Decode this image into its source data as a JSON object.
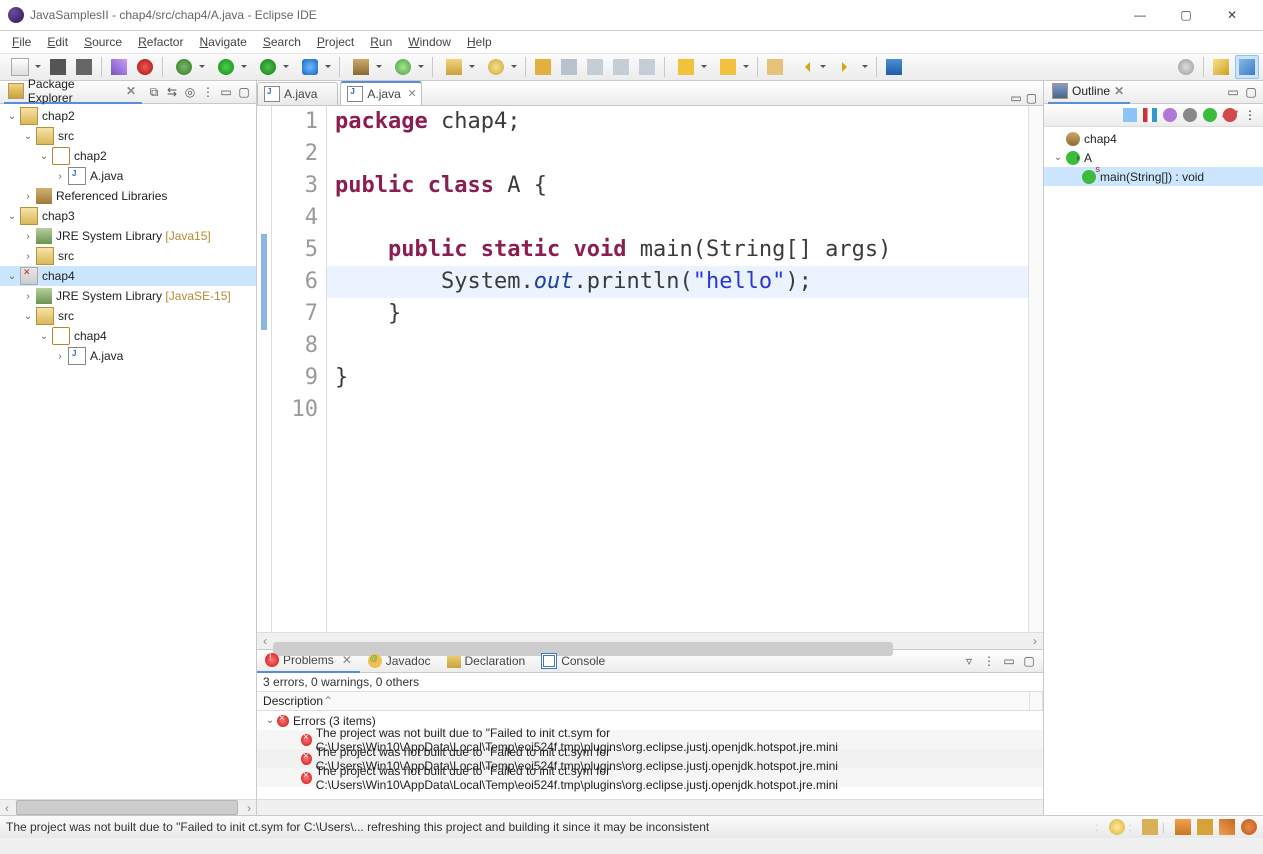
{
  "titlebar": {
    "title": "JavaSamplesII - chap4/src/chap4/A.java - Eclipse IDE"
  },
  "menu": [
    "File",
    "Edit",
    "Source",
    "Refactor",
    "Navigate",
    "Search",
    "Project",
    "Run",
    "Window",
    "Help"
  ],
  "package_explorer": {
    "title": "Package Explorer",
    "tree": {
      "chap2": {
        "label": "chap2",
        "src": "src",
        "pkg": "chap2",
        "cu": "A.java",
        "ref": "Referenced Libraries"
      },
      "chap3": {
        "label": "chap3",
        "jre": "JRE System Library",
        "jre_dim": "[Java15]",
        "src": "src"
      },
      "chap4": {
        "label": "chap4",
        "jre": "JRE System Library",
        "jre_dim": "[JavaSE-15]",
        "src": "src",
        "pkg": "chap4",
        "cu": "A.java"
      }
    }
  },
  "editor": {
    "tabs": [
      {
        "label": "A.java"
      },
      {
        "label": "A.java"
      }
    ],
    "gutter": [
      "1",
      "2",
      "3",
      "4",
      "5",
      "6",
      "7",
      "8",
      "9",
      "10"
    ],
    "code": {
      "l1a": "package",
      "l1b": " chap4;",
      "l3a": "public",
      "l3b": " ",
      "l3c": "class",
      "l3d": " A {",
      "l5a": "    ",
      "l5b": "public",
      "l5c": " ",
      "l5d": "static",
      "l5e": " ",
      "l5f": "void",
      "l5g": " main(String[] args)",
      "l6a": "        System.",
      "l6b": "out",
      "l6c": ".println(",
      "l6d": "\"hello\"",
      "l6e": ");",
      "l7": "    }",
      "l9": "}"
    }
  },
  "problems": {
    "tabs": {
      "problems": "Problems",
      "javadoc": "Javadoc",
      "declaration": "Declaration",
      "console": "Console"
    },
    "summary": "3 errors, 0 warnings, 0 others",
    "column": "Description",
    "group": "Errors (3 items)",
    "items": [
      "The project was not built due to \"Failed to init ct.sym for C:\\Users\\Win10\\AppData\\Local\\Temp\\eoi524f.tmp\\plugins\\org.eclipse.justj.openjdk.hotspot.jre.mini",
      "The project was not built due to \"Failed to init ct.sym for C:\\Users\\Win10\\AppData\\Local\\Temp\\eoi524f.tmp\\plugins\\org.eclipse.justj.openjdk.hotspot.jre.mini",
      "The project was not built due to \"Failed to init ct.sym for C:\\Users\\Win10\\AppData\\Local\\Temp\\eoi524f.tmp\\plugins\\org.eclipse.justj.openjdk.hotspot.jre.mini"
    ]
  },
  "outline": {
    "title": "Outline",
    "pkg": "chap4",
    "cls": "A",
    "method": "main(String[]) : void"
  },
  "statusbar": {
    "msg": "The project was not built due to \"Failed to init ct.sym for C:\\Users\\... refreshing this project and building it since it may be inconsistent"
  }
}
